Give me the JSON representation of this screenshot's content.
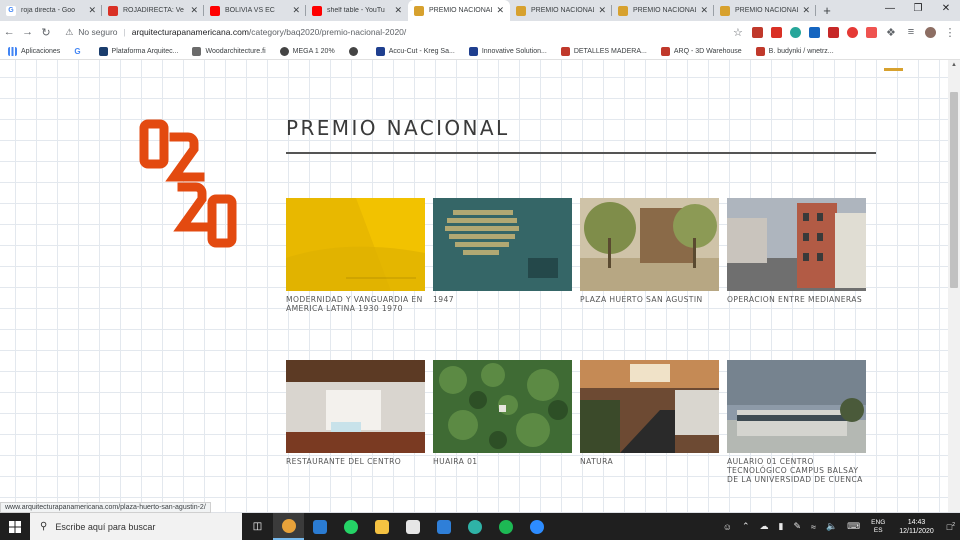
{
  "browser": {
    "tabs": [
      {
        "title": "roja directa - Goo",
        "favicon": "google-icon",
        "color": "#ffffff"
      },
      {
        "title": "ROJADIRECTA: Ve",
        "favicon": "rojadirecta-icon",
        "color": "#d93025"
      },
      {
        "title": "BOLIVIA VS EC",
        "favicon": "youtube-icon",
        "color": "#ff0000"
      },
      {
        "title": "shelf table - YouTu",
        "favicon": "youtube-icon",
        "color": "#ff0000"
      },
      {
        "title": "PREMIO NACIONAL",
        "favicon": "site-icon",
        "color": "#d7a12e"
      },
      {
        "title": "PREMIO NACIONAL",
        "favicon": "site-icon",
        "color": "#d7a12e"
      },
      {
        "title": "PREMIO NACIONAL",
        "favicon": "site-icon",
        "color": "#d7a12e"
      },
      {
        "title": "PREMIO NACIONAL",
        "favicon": "site-icon",
        "color": "#d7a12e"
      }
    ],
    "active_tab_index": 4,
    "new_tab_label": "+",
    "security_label": "No seguro",
    "url_domain": "arquitecturapanamericana.com",
    "url_path": "/category/baq2020/premio-nacional-2020/"
  },
  "bookmarks": [
    {
      "label": "Aplicaciones",
      "icon": "apps-grid-icon",
      "color": "#4285f4"
    },
    {
      "label": "",
      "icon": "google-icon",
      "color": "#ffffff"
    },
    {
      "label": "Plataforma Arquitec...",
      "icon": "bookmark-icon",
      "color": "#1a3d6d"
    },
    {
      "label": "Woodarchitecture.fi",
      "icon": "bookmark-icon",
      "color": "#6b6b6b"
    },
    {
      "label": "MEGA 1 20%",
      "icon": "globe-icon",
      "color": "#444444"
    },
    {
      "label": "",
      "icon": "globe-icon",
      "color": "#444444"
    },
    {
      "label": "Accu-Cut - Kreg Sa...",
      "icon": "bookmark-icon",
      "color": "#1f3f8f"
    },
    {
      "label": "Innovative Solution...",
      "icon": "bookmark-icon",
      "color": "#1f3f8f"
    },
    {
      "label": "DETALLES MADERA...",
      "icon": "bookmark-icon",
      "color": "#c0392b"
    },
    {
      "label": "ARQ - 3D Warehouse",
      "icon": "bookmark-icon",
      "color": "#c0392b"
    },
    {
      "label": "B. budynki / wnetrz...",
      "icon": "bookmark-icon",
      "color": "#c0392b"
    }
  ],
  "page": {
    "section_title": "PREMIO NACIONAL",
    "logo_text": "2020",
    "accent_color": "#e34a10",
    "cards": [
      {
        "caption": "MODERNIDAD Y VANGUARDIA EN AMERICA LATINA 1930 1970",
        "image": "yellow-book-cover"
      },
      {
        "caption": "1947",
        "image": "teal-map-image"
      },
      {
        "caption": "PLAZA HUERTO SAN AGUSTIN",
        "image": "plaza-photo"
      },
      {
        "caption": "OPERACION ENTRE MEDIANERAS",
        "image": "street-photo"
      },
      {
        "caption": "RESTAURANTE DEL CENTRO",
        "image": "interior-photo"
      },
      {
        "caption": "HUAIRA 01",
        "image": "forest-aerial-photo"
      },
      {
        "caption": "NATURA",
        "image": "atrium-photo"
      },
      {
        "caption": "AULARIO 01 CENTRO TECNOLÓGICO CAMPUS BALSAY DE LA UNIVERSIDAD DE CUENCA",
        "image": "building-photo"
      }
    ]
  },
  "status_bar": {
    "url": "www.arquitecturapanamericana.com/plaza-huerto-san-agustin-2/"
  },
  "taskbar": {
    "search_placeholder": "Escribe aquí para buscar",
    "lang_top": "ENG",
    "lang_bottom": "ES",
    "time": "14:43",
    "date": "12/11/2020",
    "notification_count": "2"
  }
}
